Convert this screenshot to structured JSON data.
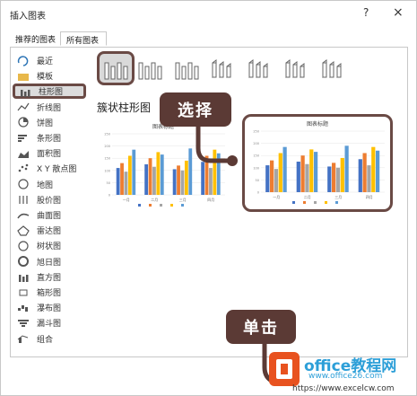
{
  "window": {
    "title": "插入图表",
    "help": "?",
    "close": "×"
  },
  "tabs": [
    {
      "label": "推荐的图表"
    },
    {
      "label": "所有图表"
    }
  ],
  "sidebar": {
    "items": [
      {
        "label": "最近",
        "icon": "recent-icon"
      },
      {
        "label": "模板",
        "icon": "template-folder-icon"
      },
      {
        "label": "柱形图",
        "icon": "column-chart-icon",
        "selected": true
      },
      {
        "label": "折线图",
        "icon": "line-chart-icon"
      },
      {
        "label": "饼图",
        "icon": "pie-chart-icon"
      },
      {
        "label": "条形图",
        "icon": "bar-chart-icon"
      },
      {
        "label": "面积图",
        "icon": "area-chart-icon"
      },
      {
        "label": "X Y 散点图",
        "icon": "scatter-chart-icon"
      },
      {
        "label": "地图",
        "icon": "map-chart-icon"
      },
      {
        "label": "股价图",
        "icon": "stock-chart-icon"
      },
      {
        "label": "曲面图",
        "icon": "surface-chart-icon"
      },
      {
        "label": "雷达图",
        "icon": "radar-chart-icon"
      },
      {
        "label": "树状图",
        "icon": "treemap-chart-icon"
      },
      {
        "label": "旭日图",
        "icon": "sunburst-chart-icon"
      },
      {
        "label": "直方图",
        "icon": "histogram-chart-icon"
      },
      {
        "label": "箱形图",
        "icon": "box-chart-icon"
      },
      {
        "label": "瀑布图",
        "icon": "waterfall-chart-icon"
      },
      {
        "label": "漏斗图",
        "icon": "funnel-chart-icon"
      },
      {
        "label": "组合",
        "icon": "combo-chart-icon"
      }
    ]
  },
  "subtypes": [
    {
      "name": "clustered-column",
      "selected": true
    },
    {
      "name": "stacked-column"
    },
    {
      "name": "100-stacked-column"
    },
    {
      "name": "3d-clustered-column"
    },
    {
      "name": "3d-stacked-column"
    },
    {
      "name": "3d-100-stacked-column"
    },
    {
      "name": "3d-column"
    }
  ],
  "main": {
    "chart_type_title": "簇状柱形图"
  },
  "preview_left": {
    "title": "图表标题"
  },
  "preview_right": {
    "title": "图表标题"
  },
  "callouts": {
    "select": "选择",
    "click": "单击"
  },
  "watermark": {
    "brand": "office教程网",
    "url": "www.office26.com",
    "url2": "https://www.excelcw.com"
  },
  "colors": {
    "accent_callout": "#5b3a35",
    "series": [
      "#4472c4",
      "#ed7d31",
      "#a5a5a5",
      "#ffc000",
      "#5b9bd5"
    ]
  },
  "chart_data": {
    "type": "bar",
    "categories": [
      "一月",
      "二月",
      "三月",
      "四月"
    ],
    "series": [
      {
        "values": [
          110,
          125,
          105,
          135
        ]
      },
      {
        "values": [
          130,
          150,
          120,
          160
        ]
      },
      {
        "values": [
          95,
          115,
          100,
          110
        ]
      },
      {
        "values": [
          160,
          175,
          140,
          185
        ]
      },
      {
        "values": [
          185,
          165,
          190,
          170
        ]
      }
    ],
    "ylim": [
      0,
      250
    ]
  }
}
